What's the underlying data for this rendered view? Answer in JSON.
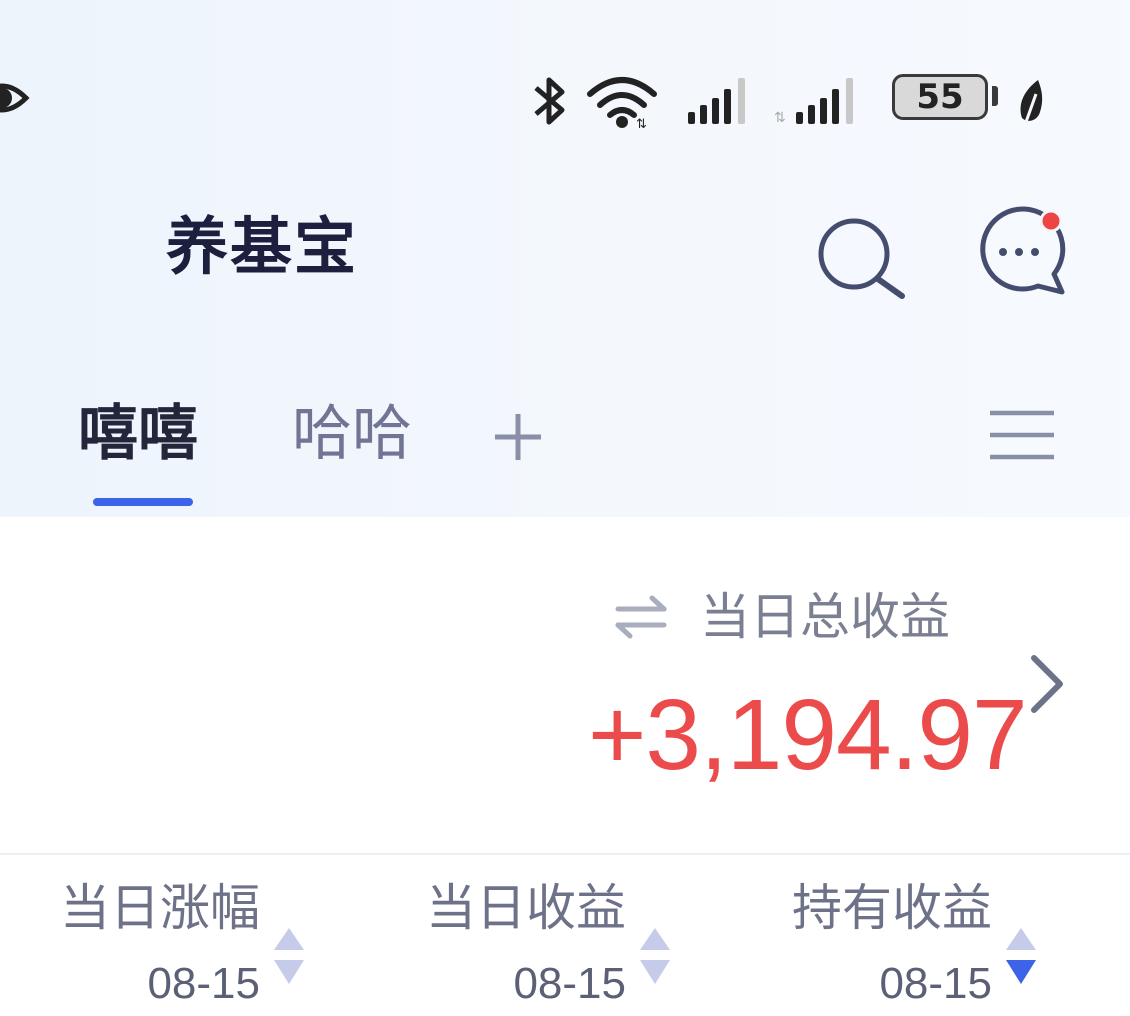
{
  "status_bar": {
    "battery_level": "55",
    "icons": [
      "eye-icon",
      "bluetooth-icon",
      "wifi-icon",
      "signal-icon",
      "signal-icon",
      "battery-icon",
      "leaf-icon"
    ]
  },
  "header": {
    "title": "养基宝",
    "icons": [
      "search-icon",
      "message-icon"
    ],
    "notification_dot": true
  },
  "tabs": {
    "items": [
      {
        "label": "嘻嘻",
        "active": true
      },
      {
        "label": "哈哈",
        "active": false
      }
    ],
    "add_symbol": "+",
    "icons": [
      "add-tab-icon",
      "menu-icon"
    ]
  },
  "summary": {
    "label": "当日总收益",
    "value": "+3,194.97",
    "icons": [
      "swap-icon",
      "chevron-right-icon"
    ]
  },
  "columns": [
    {
      "label": "当日涨幅",
      "date": "08-15",
      "sort": "none"
    },
    {
      "label": "当日收益",
      "date": "08-15",
      "sort": "none"
    },
    {
      "label": "持有收益",
      "date": "08-15",
      "sort": "desc"
    }
  ],
  "colors": {
    "accent": "#3c63e8",
    "gain": "#ec4b4b",
    "notification": "#ef4444",
    "sort_inactive": "#c5cbe9"
  }
}
